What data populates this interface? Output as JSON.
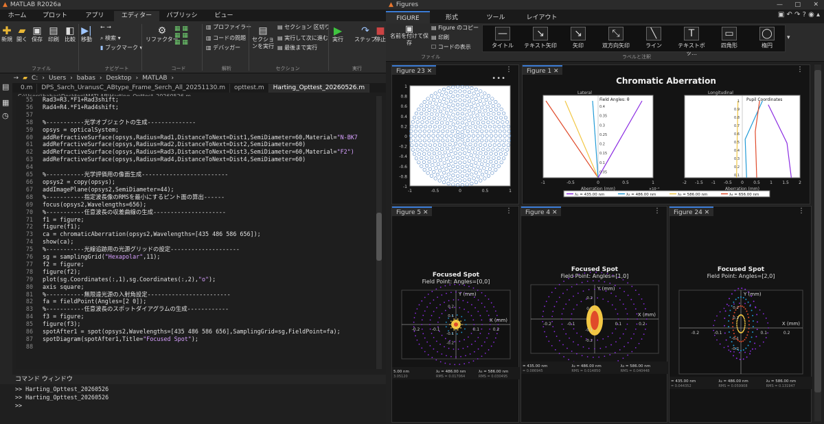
{
  "left": {
    "title": "MATLAB R2026a",
    "ribbon_tabs": [
      "ホーム",
      "プロット",
      "アプリ",
      "エディター",
      "パブリッシュ",
      "ビュー"
    ],
    "active_tab": "エディター",
    "buttons": {
      "new": "新規",
      "open": "開く",
      "save": "保存",
      "print": "印刷",
      "compare": "比較",
      "goto": "移動",
      "search": "検索",
      "bookmark": "ブックマーク",
      "refactor": "リファクター",
      "profiler": "プロファイラー",
      "codeissues": "コードの問題",
      "debugger": "デバッガー",
      "runsection": "セクションを実行",
      "sectionbreak": "セクション 区切り",
      "runadvance": "実行して次に進む",
      "runtoend": "最後まで実行",
      "run": "実行",
      "step": "ステップ",
      "stop": "停止"
    },
    "sections": {
      "file": "ファイル",
      "navigate": "ナビゲート",
      "code": "コード",
      "analyze": "解析",
      "section": "セクション",
      "run": "実行"
    },
    "path": [
      "C:",
      "Users",
      "babas",
      "Desktop",
      "MATLAB"
    ],
    "editor_tabs": [
      "0.m",
      "DPS_Sarch_UranusC_ABtype_Frame_Serch_All_20251130.m",
      "opttest.m",
      "Harting_Opttest_20260526.m"
    ],
    "active_editor_tab": "Harting_Opttest_20260526.m",
    "filepath": "C:\\Users\\babas\\Desktop\\MATLAB\\Harting_Opttest_20260526.m",
    "code_lines": [
      {
        "n": "55",
        "t": "Rad3=R3.*F1+Rad3shift;",
        "k": ""
      },
      {
        "n": "56",
        "t": "Rad4=R4.*F1+Rad4shift;",
        "k": ""
      },
      {
        "n": "57",
        "t": "",
        "k": ""
      },
      {
        "n": "58",
        "t": "%-----------光学オブジェクトの生成--------------",
        "k": "cm"
      },
      {
        "n": "59",
        "t": "opsys = opticalSystem;",
        "k": ""
      },
      {
        "n": "60",
        "t": "addRefractiveSurface(opsys,Radius=Rad1,DistanceToNext=Dist1,SemiDiameter=60,Material=",
        "k": "",
        "s": "\"N-BK7"
      },
      {
        "n": "61",
        "t": "addRefractiveSurface(opsys,Radius=Rad2,DistanceToNext=Dist2,SemiDiameter=60)",
        "k": ""
      },
      {
        "n": "62",
        "t": "addRefractiveSurface(opsys,Radius=Rad3,DistanceToNext=Dist3,SemiDiameter=60,Material=",
        "k": "",
        "s": "\"F2\")"
      },
      {
        "n": "63",
        "t": "addRefractiveSurface(opsys,Radius=Rad4,DistanceToNext=Dist4,SemiDiameter=60)",
        "k": ""
      },
      {
        "n": "64",
        "t": "",
        "k": ""
      },
      {
        "n": "65",
        "t": "%-----------光学評価用の像面生成-------------------------",
        "k": "cm"
      },
      {
        "n": "66",
        "t": "opsys2 = copy(opsys);",
        "k": ""
      },
      {
        "n": "67",
        "t": "addImagePlane(opsys2,SemiDiameter=44);",
        "k": ""
      },
      {
        "n": "68",
        "t": "%-----------指定波長像のRMSを最小にするピント面の算出------",
        "k": "cm"
      },
      {
        "n": "69",
        "t": "focus(opsys2,Wavelengths=656);",
        "k": ""
      },
      {
        "n": "70",
        "t": "%-----------任意波長の収差曲線の生成---------------------",
        "k": "cm"
      },
      {
        "n": "71",
        "t": "f1 = figure;",
        "k": ""
      },
      {
        "n": "72",
        "t": "figure(f1);",
        "k": ""
      },
      {
        "n": "73",
        "t": "ca = chromaticAberration(opsys2,Wavelengths=[435 486 586 656]);",
        "k": ""
      },
      {
        "n": "74",
        "t": "show(ca);",
        "k": ""
      },
      {
        "n": "75",
        "t": "%-----------光線追跡用の光源グリッドの設定--------------------",
        "k": "cm"
      },
      {
        "n": "76",
        "t": "sg = samplingGrid(",
        "k": "",
        "s": "\"Hexapolar\"",
        "r": ",11);"
      },
      {
        "n": "77",
        "t": "f2 = figure;",
        "k": ""
      },
      {
        "n": "78",
        "t": "figure(f2);",
        "k": ""
      },
      {
        "n": "79",
        "t": "plot(sg.Coordinates(:,1),sg.Coordinates(:,2),",
        "k": "",
        "s": "\"o\"",
        "r": ");"
      },
      {
        "n": "80",
        "t": "axis square;",
        "k": ""
      },
      {
        "n": "81",
        "t": "%-----------無限遠光源の入射角設定------------------------",
        "k": "cm"
      },
      {
        "n": "82",
        "t": "fa = fieldPoint(Angles=[2 0]);",
        "k": ""
      },
      {
        "n": "83",
        "t": "%-----------任意波長のスポットダイアグラムの生成------------",
        "k": "cm"
      },
      {
        "n": "84",
        "t": "f3 = figure;",
        "k": ""
      },
      {
        "n": "85",
        "t": "figure(f3);",
        "k": ""
      },
      {
        "n": "86",
        "t": "spotAfter1 = spot(opsys2,Wavelengths=[435 486 586 656],SamplingGrid=sg,FieldPoint=fa);",
        "k": ""
      },
      {
        "n": "87",
        "t": "spotDiagram(spotAfter1,Title=",
        "k": "",
        "s": "\"Focused Spot\"",
        "r": ");"
      },
      {
        "n": "88",
        "t": "",
        "k": ""
      }
    ],
    "command_window": "コマンド ウィンドウ",
    "command_lines": [
      ">> Harting_Opttest_20260526",
      ">> Harting_Opttest_20260526",
      ">>"
    ]
  },
  "right": {
    "title": "Figures",
    "ribbon_tabs": [
      "FIGURE",
      "形式",
      "ツール",
      "レイアウト"
    ],
    "active_tab": "FIGURE",
    "buttons": {
      "saveas": "名前を付けて保存",
      "copy": "Figure のコピー",
      "print": "印刷",
      "showcode": "コードの表示"
    },
    "file_section": "ファイル",
    "labels_section": "ラベルと注釈",
    "annot": [
      "タイトル",
      "テキスト矢印",
      "矢印",
      "双方向矢印",
      "ライン",
      "テキストボッ…",
      "四角形",
      "楕円"
    ],
    "fig_tabs": {
      "f23": "Figure 23",
      "f1": "Figure 1",
      "f5": "Figure 5",
      "f4": "Figure 4",
      "f24": "Figure 24"
    },
    "ca_title": "Chromatic Aberration",
    "lateral": {
      "title": "Lateral",
      "sub": "Field Angles: θ",
      "xlabel": "Aberration (mm)",
      "xexp": "×10⁻⁴",
      "xticks": [
        "-1",
        "-0.5",
        "0",
        "0.5",
        "1"
      ],
      "yticks": [
        "0.4",
        "0.35",
        "0.3",
        "0.25",
        "0.2",
        "0.15",
        "0.1",
        "0.05"
      ]
    },
    "longitudinal": {
      "title": "Longitudinal",
      "sub": "Pupil Coordinates",
      "xlabel": "Aberration (mm)",
      "xticks": [
        "-2",
        "-1.5",
        "-1",
        "-0.5",
        "0",
        "0.5",
        "1",
        "1.5",
        "2"
      ],
      "yticks": [
        "1",
        "0.9",
        "0.8",
        "0.7",
        "0.6",
        "0.5",
        "0.4",
        "0.3",
        "0.2",
        "0.1"
      ]
    },
    "legend": [
      "λ₁ = 435.00 nm",
      "λ₂ = 486.00 nm",
      "λ₃ = 586.00 nm",
      "λ₄ = 656.00 nm"
    ],
    "colors": {
      "l1": "#8a2be2",
      "l2": "#1f9ad6",
      "l3": "#f2c744",
      "l4": "#e04a2a"
    },
    "f23": {
      "yticks": [
        "1",
        "0.8",
        "0.6",
        "0.4",
        "0.2",
        "0",
        "-0.2",
        "-0.4",
        "-0.6",
        "-0.8",
        "-1"
      ],
      "xticks": [
        "-1",
        "-0.5",
        "0",
        "0.5",
        "1"
      ]
    },
    "spots": [
      {
        "title": "Focused Spot",
        "field": "Field Point: Angles=[0,0]",
        "xticks": [
          "-0.2",
          "-0.1",
          "0.1",
          "0.2"
        ],
        "yticks": [
          "0.2",
          "0.1",
          "-0.1",
          "-0.2"
        ],
        "xunit": "X (mm)",
        "yunit": "Y (mm)",
        "leg": [
          "5.00 nm",
          "λ₂ = 486.00 nm",
          "λ₃ = 586.00 nm"
        ],
        "rms": [
          "3.05120",
          "RMS = 0.017064",
          "RMS = 0.030495"
        ]
      },
      {
        "title": "Focused Spot",
        "field": "Field Point: Angles=[1,0]",
        "xticks": [
          "-0.2",
          "-0.1",
          "0.1",
          "0.2"
        ],
        "yticks": [
          "0.2",
          "0.1",
          "-0.1",
          "-0.2"
        ],
        "xunit": "X (mm)",
        "yunit": "Y (mm)",
        "leg": [
          "= 435.00 nm",
          "λ₂ = 486.00 nm",
          "λ₃ = 586.00 nm"
        ],
        "rms": [
          "= 0.086945",
          "RMS = 0.014850",
          "RMS = 0.040448"
        ]
      },
      {
        "title": "Focused Spot",
        "field": "Field Point: Angles=[2,0]",
        "xticks": [
          "-0.2",
          "-0.1",
          "0.1",
          "0.2"
        ],
        "yticks": [
          "0.2",
          "0.1",
          "-0.1",
          "-0.2"
        ],
        "xunit": "X (mm)",
        "yunit": "Y (mm)",
        "leg": [
          "= 435.00 nm",
          "λ₂ = 486.00 nm",
          "λ₃ = 586.00 nm"
        ],
        "rms": [
          "= 0.044352",
          "RMS = 0.059908",
          "RMS = 0.131947"
        ]
      }
    ]
  }
}
